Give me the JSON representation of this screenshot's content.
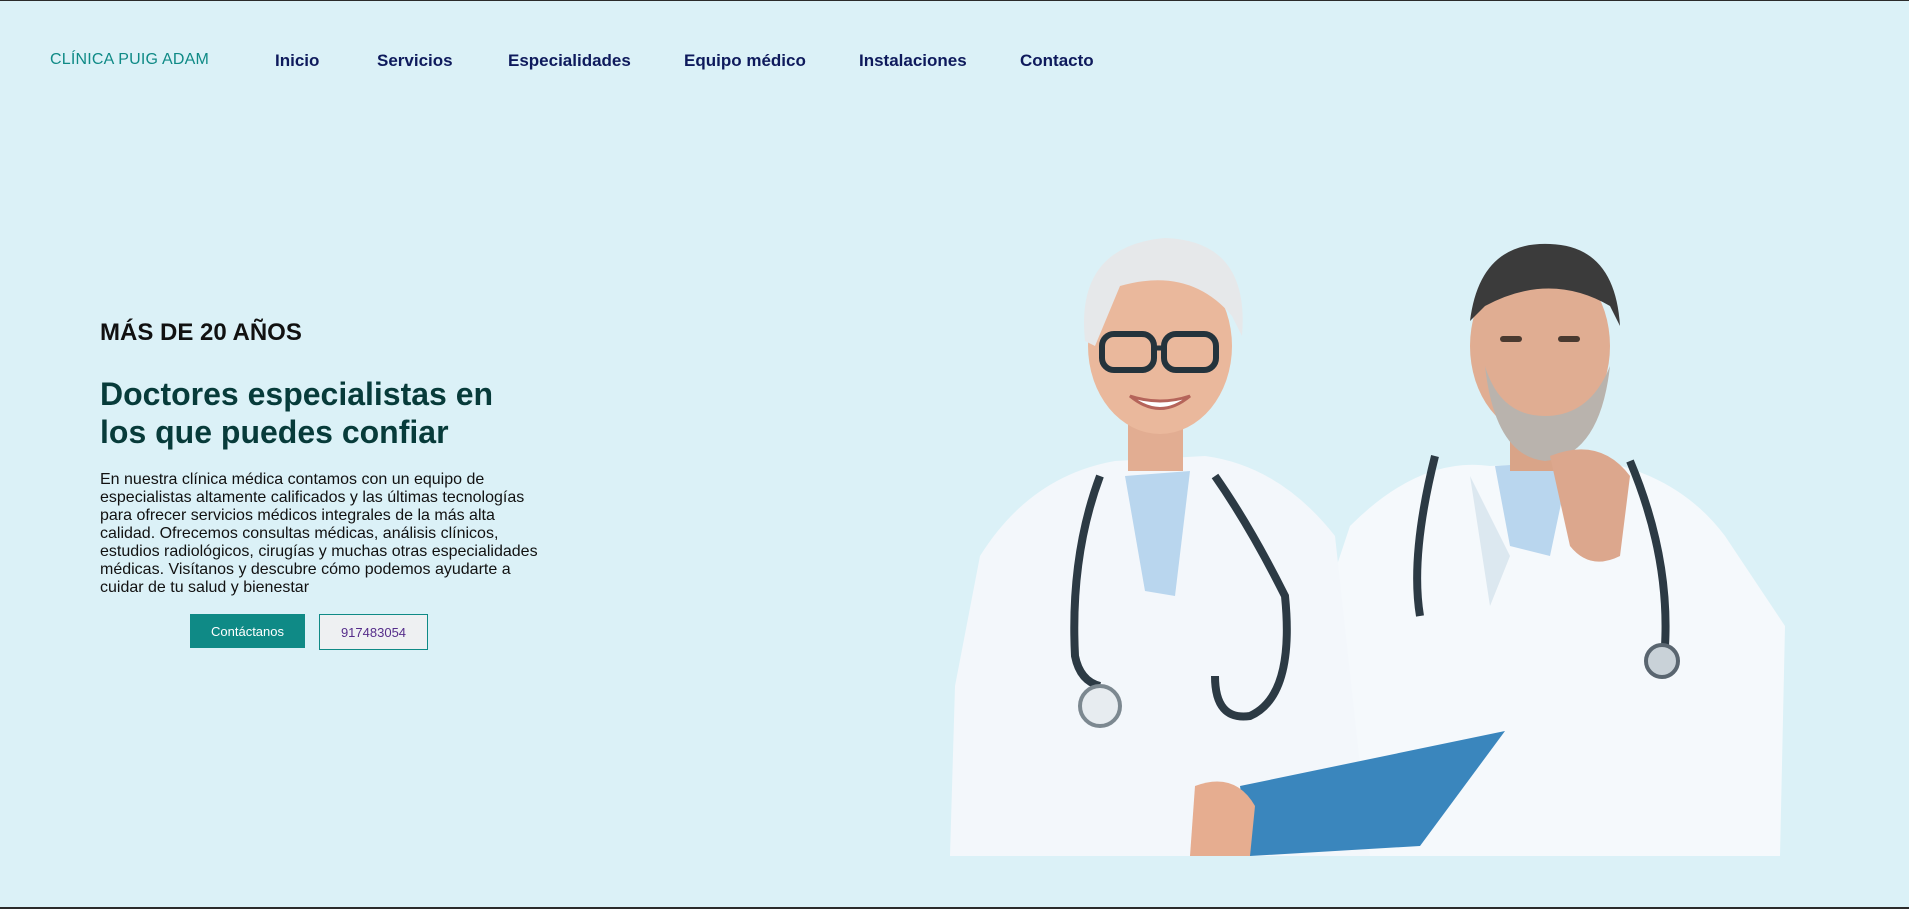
{
  "nav": {
    "brand": "CLÍNICA PUIG ADAM",
    "items": [
      {
        "label": "Inicio"
      },
      {
        "label": "Servicios"
      },
      {
        "label": "Especialidades"
      },
      {
        "label": "Equipo médico"
      },
      {
        "label": "Instalaciones"
      },
      {
        "label": "Contacto"
      }
    ]
  },
  "hero": {
    "kicker": "MÁS DE 20 AÑOS",
    "headline": "Doctores especialistas en los que puedes confiar",
    "description": "En nuestra clínica médica contamos con un equipo de especialistas altamente calificados y las últimas tecnologías para ofrecer servicios médicos integrales de la más alta calidad. Ofrecemos consultas médicas, análisis clínicos, estudios radiológicos, cirugías y muchas otras especialidades médicas. Visítanos y descubre cómo podemos ayudarte a cuidar de tu salud y bienestar",
    "primary_button": "Contáctanos",
    "phone_button": "917483054",
    "image_icon": "doctors-photo"
  },
  "colors": {
    "background": "#dbf1f7",
    "accent": "#0f8a86",
    "nav_text": "#0e1a5c",
    "headline": "#073b3a",
    "phone_text": "#552c8a"
  }
}
